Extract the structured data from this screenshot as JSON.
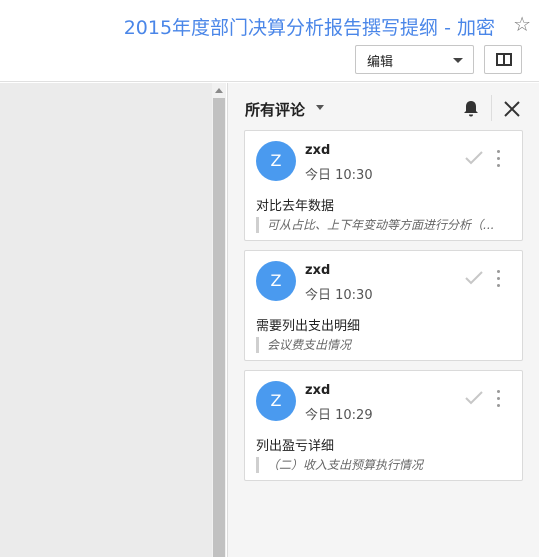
{
  "document": {
    "title": "2015年度部门决算分析报告撰写提纲 - 加密"
  },
  "toolbar": {
    "mode_label": "编辑"
  },
  "comments_panel": {
    "title": "所有评论",
    "comments": [
      {
        "avatar_letter": "Z",
        "author": "zxd",
        "time": "今日 10:30",
        "text": "对比去年数据",
        "quote": "可从占比、上下年变动等方面进行分析（..."
      },
      {
        "avatar_letter": "Z",
        "author": "zxd",
        "time": "今日 10:30",
        "text": "需要列出支出明细",
        "quote": "会议费支出情况"
      },
      {
        "avatar_letter": "Z",
        "author": "zxd",
        "time": "今日 10:29",
        "text": "列出盈亏详细",
        "quote": "（二）收入支出预算执行情况"
      }
    ]
  },
  "colors": {
    "accent": "#4a86e8",
    "avatar": "#4a9aef"
  },
  "icons": [
    "star-icon",
    "chevron-down-icon",
    "side-panel-icon",
    "bell-icon",
    "close-icon",
    "check-icon",
    "more-vert-icon"
  ]
}
